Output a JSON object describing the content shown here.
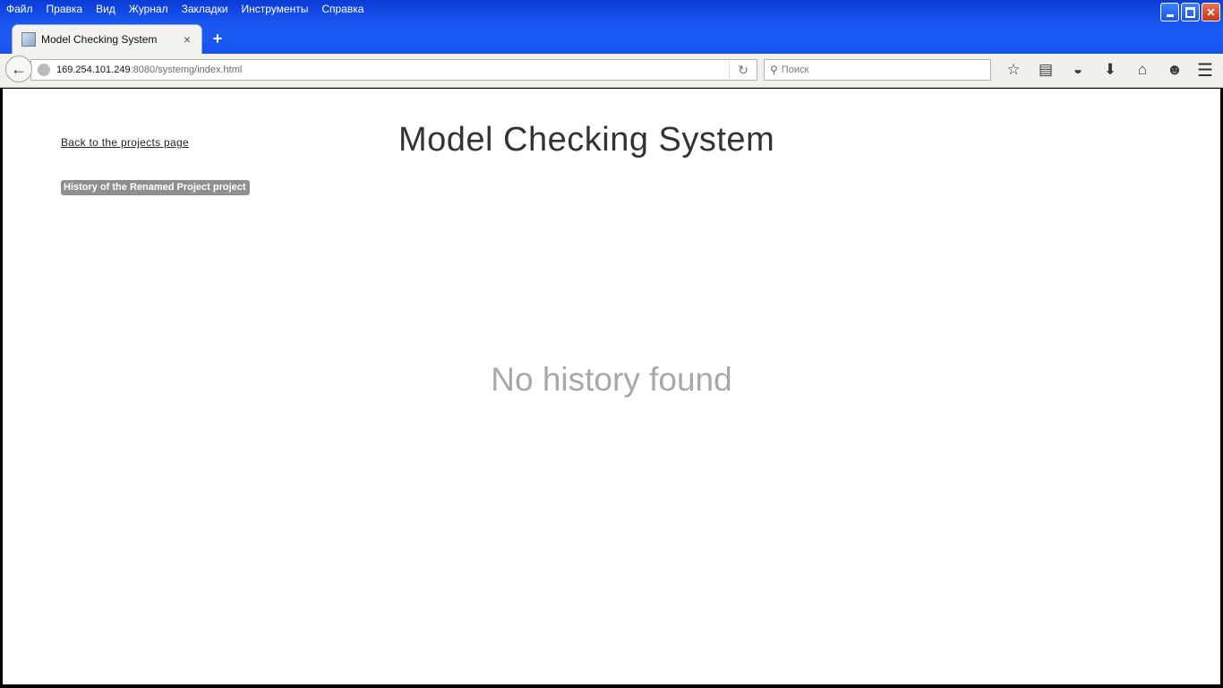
{
  "window": {
    "minimize_icon": "minimize-icon",
    "restore_icon": "restore-icon",
    "close_icon": "close-icon"
  },
  "menu": {
    "items": [
      "Файл",
      "Правка",
      "Вид",
      "Журнал",
      "Закладки",
      "Инструменты",
      "Справка"
    ]
  },
  "tab": {
    "title": "Model Checking System",
    "close_glyph": "×",
    "new_tab_glyph": "+"
  },
  "nav": {
    "url_host": "169.254.101.249",
    "url_rest": ":8080/systemg/index.html",
    "search_placeholder": "Поиск"
  },
  "page": {
    "back_link": "Back to the projects page",
    "title": "Model Checking System",
    "history_label": "History of the Renamed Project project",
    "empty_message": "No history found"
  },
  "colors": {
    "titlebar": "#1c5bf5",
    "badge": "#8f8f8f",
    "empty_text": "#a8a8a8"
  }
}
